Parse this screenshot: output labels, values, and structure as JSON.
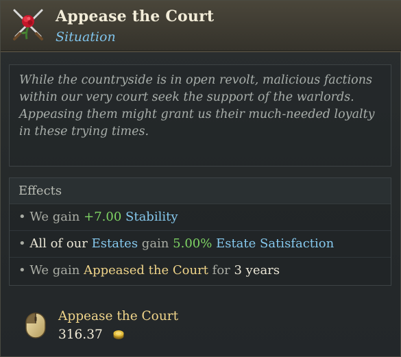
{
  "header": {
    "title": "Appease the Court",
    "subtitle": "Situation",
    "icon": "crossed-swords-rose-icon"
  },
  "description": "While the countryside is in open revolt, malicious factions within our very court seek the support of the warlords. Appeasing them might grant us their much-needed loyalty in these trying times.",
  "effects": {
    "heading": "Effects",
    "rows": [
      {
        "bullet": "•",
        "parts": [
          "We gain",
          "+7.00",
          "Stability"
        ]
      },
      {
        "bullet": "•",
        "parts": [
          "All of our",
          "Estates",
          "gain",
          "5.00%",
          "Estate Satisfaction"
        ]
      },
      {
        "bullet": "•",
        "parts": [
          "We gain",
          "Appeased the Court",
          "for",
          "3 years"
        ]
      }
    ]
  },
  "action": {
    "label": "Appease the Court",
    "cost": "316.37",
    "mouse_icon": "mouse-left-click-icon",
    "currency_icon": "gold-coin-icon"
  },
  "colors": {
    "title": "#f2ecd8",
    "subtitle": "#7fc3ea",
    "positive": "#7ed364",
    "link": "#86c9ee",
    "highlight": "#f0d58a"
  }
}
